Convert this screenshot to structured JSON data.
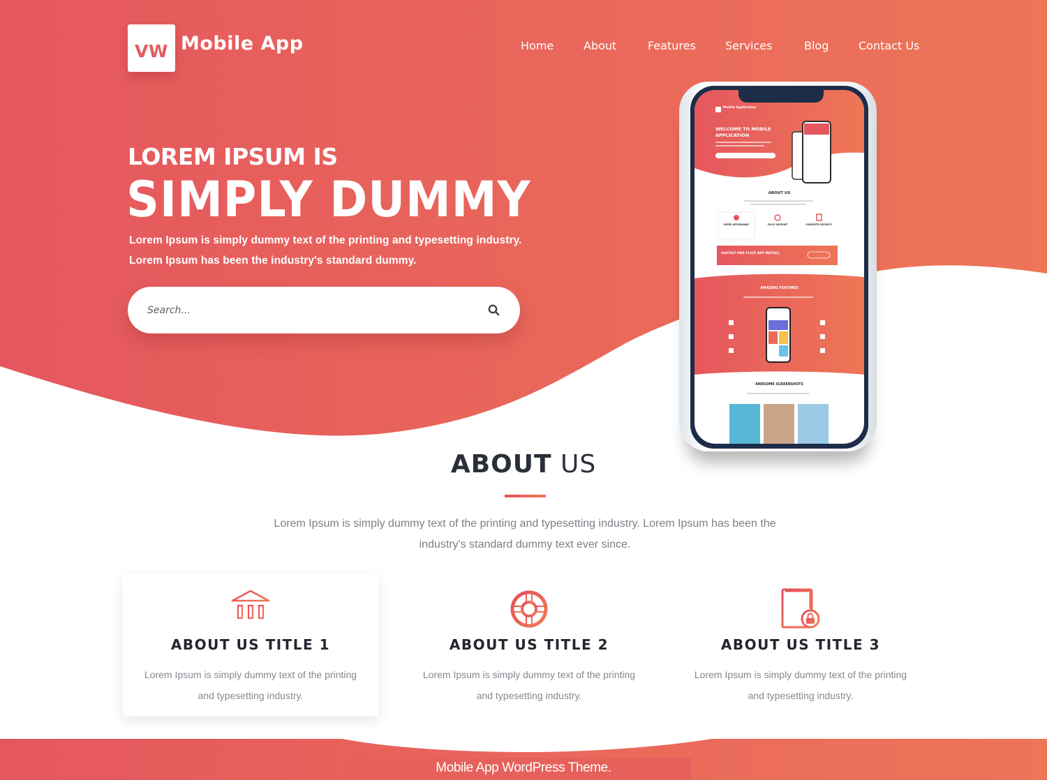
{
  "brand": {
    "logo_mark": "VW",
    "name": "Mobile App"
  },
  "nav": {
    "items": [
      {
        "label": "Home"
      },
      {
        "label": "About"
      },
      {
        "label": "Features"
      },
      {
        "label": "Services"
      },
      {
        "label": "Blog"
      },
      {
        "label": "Contact Us"
      }
    ]
  },
  "hero": {
    "kicker": "LOREM IPSUM IS",
    "title": "SIMPLY DUMMY",
    "subtitle_lines": [
      "Lorem Ipsum is simply dummy text of the printing and typesetting industry.",
      "Lorem Ipsum has been the industry's standard dummy."
    ],
    "search": {
      "placeholder": "Search...",
      "value": "",
      "button_icon": "search-icon"
    }
  },
  "phone_preview": {
    "brand": "Mobile Application",
    "hero_title_lines": [
      "WELCOME TO MOBILE",
      "APPLICATION"
    ],
    "about_title": "ABOUT US",
    "about_items": [
      "SUPER AFFORDABLE",
      "FULLY SUPPORT",
      "CONCRETE SECURITY"
    ],
    "install_banner": "QUICKLY ONE-CLICK APP INSTALL",
    "features_title": "AMAZING FEATURES",
    "screenshots_title": "AWESOME SCREENSHOTS"
  },
  "about": {
    "title_bold": "ABOUT",
    "title_light": "US",
    "description": "Lorem Ipsum is simply dummy text of the printing and typesetting industry. Lorem Ipsum has been the industry's standard dummy text ever since.",
    "cards": [
      {
        "icon": "bank-building-icon",
        "title": "ABOUT US TITLE 1",
        "text": "Lorem Ipsum is simply dummy text of the printing and typesetting industry."
      },
      {
        "icon": "lifebuoy-support-icon",
        "title": "ABOUT US TITLE 2",
        "text": "Lorem Ipsum is simply dummy text of the printing and typesetting industry."
      },
      {
        "icon": "document-lock-icon",
        "title": "ABOUT US TITLE 3",
        "text": "Lorem Ipsum is simply dummy text of the printing and typesetting industry."
      }
    ]
  },
  "footer": {
    "text": "Mobile App WordPress Theme."
  },
  "colors": {
    "gradient_start": "#e5575e",
    "gradient_end": "#ed7558",
    "heading_dark": "#2b2f3a",
    "body_gray": "#7d7f86",
    "white": "#ffffff"
  }
}
